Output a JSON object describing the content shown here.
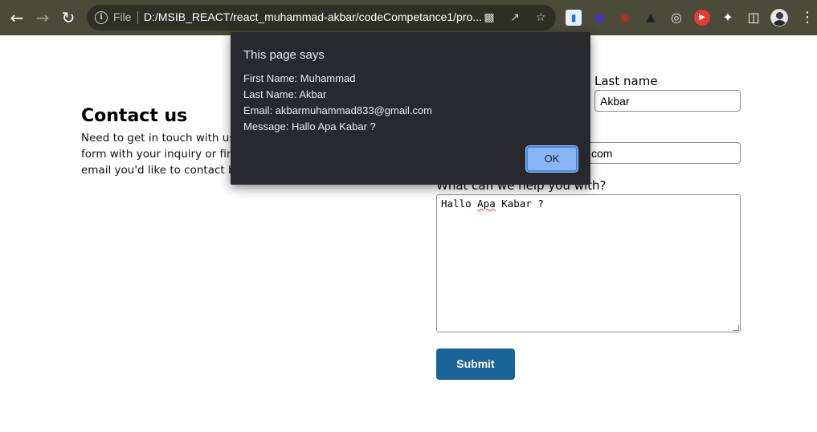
{
  "browser": {
    "file_label": "File",
    "url": "D:/MSIB_REACT/react_muhammad-akbar/codeCompetance1/pro..."
  },
  "page": {
    "contact_title": "Contact us",
    "contact_desc": [
      "Need to get in touch with us?",
      "form with your inquiry or find",
      "email you'd like to contact be"
    ],
    "last_name_label": "Last name",
    "last_name_value": "Akbar",
    "email_value_visible": "com",
    "message_label": "What can we help you with?",
    "message_value_pre": "Hallo ",
    "message_value_typo": "Apa",
    "message_value_post": " Kabar ?",
    "submit_label": "Submit"
  },
  "dialog": {
    "title": "This page says",
    "lines": [
      "First Name: Muhammad",
      "Last Name: Akbar",
      "Email: akbarmuhammad833@gmail.com",
      "Message: Hallo Apa Kabar ?"
    ],
    "ok_label": "OK"
  },
  "colors": {
    "toolbar": "#4a4b38",
    "submit": "#1a6397",
    "dialog_bg": "#28292d",
    "ok_button": "#8ab4f8"
  }
}
